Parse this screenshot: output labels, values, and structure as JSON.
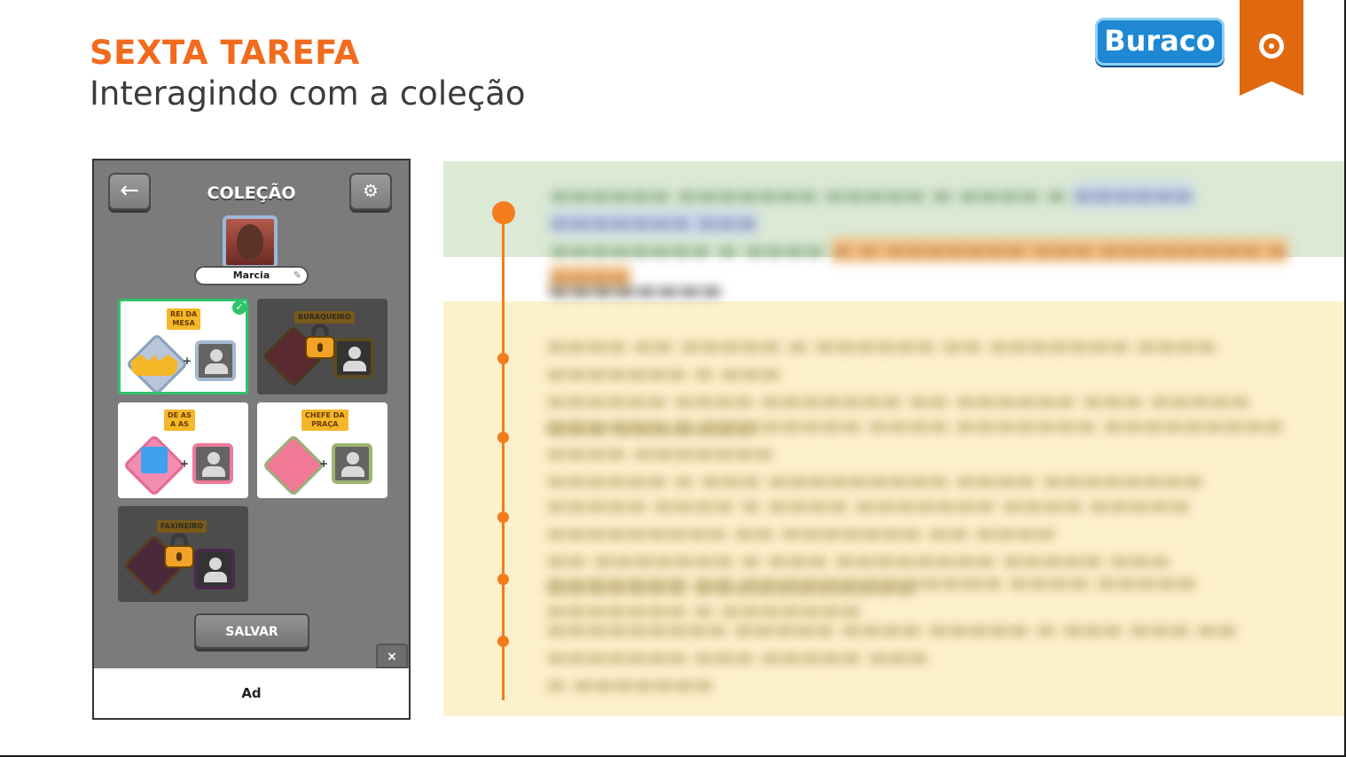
{
  "header": {
    "task_label": "SEXTA TAREFA",
    "title": "Interagindo com a coleção",
    "game_logo_text": "Buraco",
    "brand_icon": "company-swirl-icon"
  },
  "phone": {
    "screen_title": "COLEÇÃO",
    "back_icon": "arrow-left-icon",
    "settings_icon": "gears-icon",
    "player_name": "Marcia",
    "edit_icon": "pencil-icon",
    "cards": [
      {
        "title_line1": "REI DA",
        "title_line2": "MESA",
        "status": "completed"
      },
      {
        "title_line1": "BURAQUEIRO",
        "title_line2": "",
        "status": "locked"
      },
      {
        "title_line1": "DE AS",
        "title_line2": "A AS",
        "status": "available"
      },
      {
        "title_line1": "CHEFE DA",
        "title_line2": "PRAÇA",
        "status": "available"
      },
      {
        "title_line1": "FAXINEIRO",
        "title_line2": "",
        "status": "locked"
      }
    ],
    "plus_sign": "+",
    "save_label": "SALVAR",
    "close_ad_glyph": "×",
    "ad_label": "Ad"
  },
  "colors": {
    "accent_orange": "#f26b1d",
    "summary_band": "#dbe9d5",
    "findings_band": "#fdf0cc",
    "timeline": "#f47c1c",
    "selected_card": "#2fc46a"
  }
}
